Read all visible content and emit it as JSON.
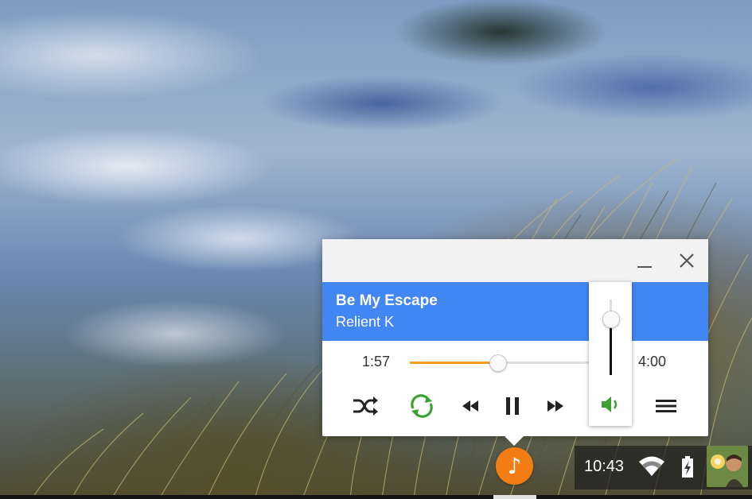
{
  "player": {
    "track_title": "Be My Escape",
    "artist": "Relient K",
    "elapsed_time": "1:57",
    "total_time": "4:00",
    "progress_fraction": 0.49,
    "volume_fraction": 0.75,
    "window_buttons": {
      "minimize_icon": "minimize-icon",
      "close_icon": "close-icon"
    },
    "controls": [
      {
        "name": "shuffle-icon"
      },
      {
        "name": "repeat-icon"
      },
      {
        "name": "previous-icon"
      },
      {
        "name": "pause-icon"
      },
      {
        "name": "next-icon"
      },
      {
        "name": "volume-icon"
      },
      {
        "name": "playlist-icon"
      }
    ],
    "colors": {
      "banner": "#4286f4",
      "progress": "#f39c22",
      "repeat_active": "#3ba132",
      "volume_active": "#3ba132"
    }
  },
  "shelf": {
    "app_icon": "music-note-icon",
    "app_icon_color": "#f47c14",
    "clock": "10:43",
    "tray_icons": [
      "wifi-icon",
      "battery-charging-icon"
    ],
    "avatar": "user-avatar"
  }
}
